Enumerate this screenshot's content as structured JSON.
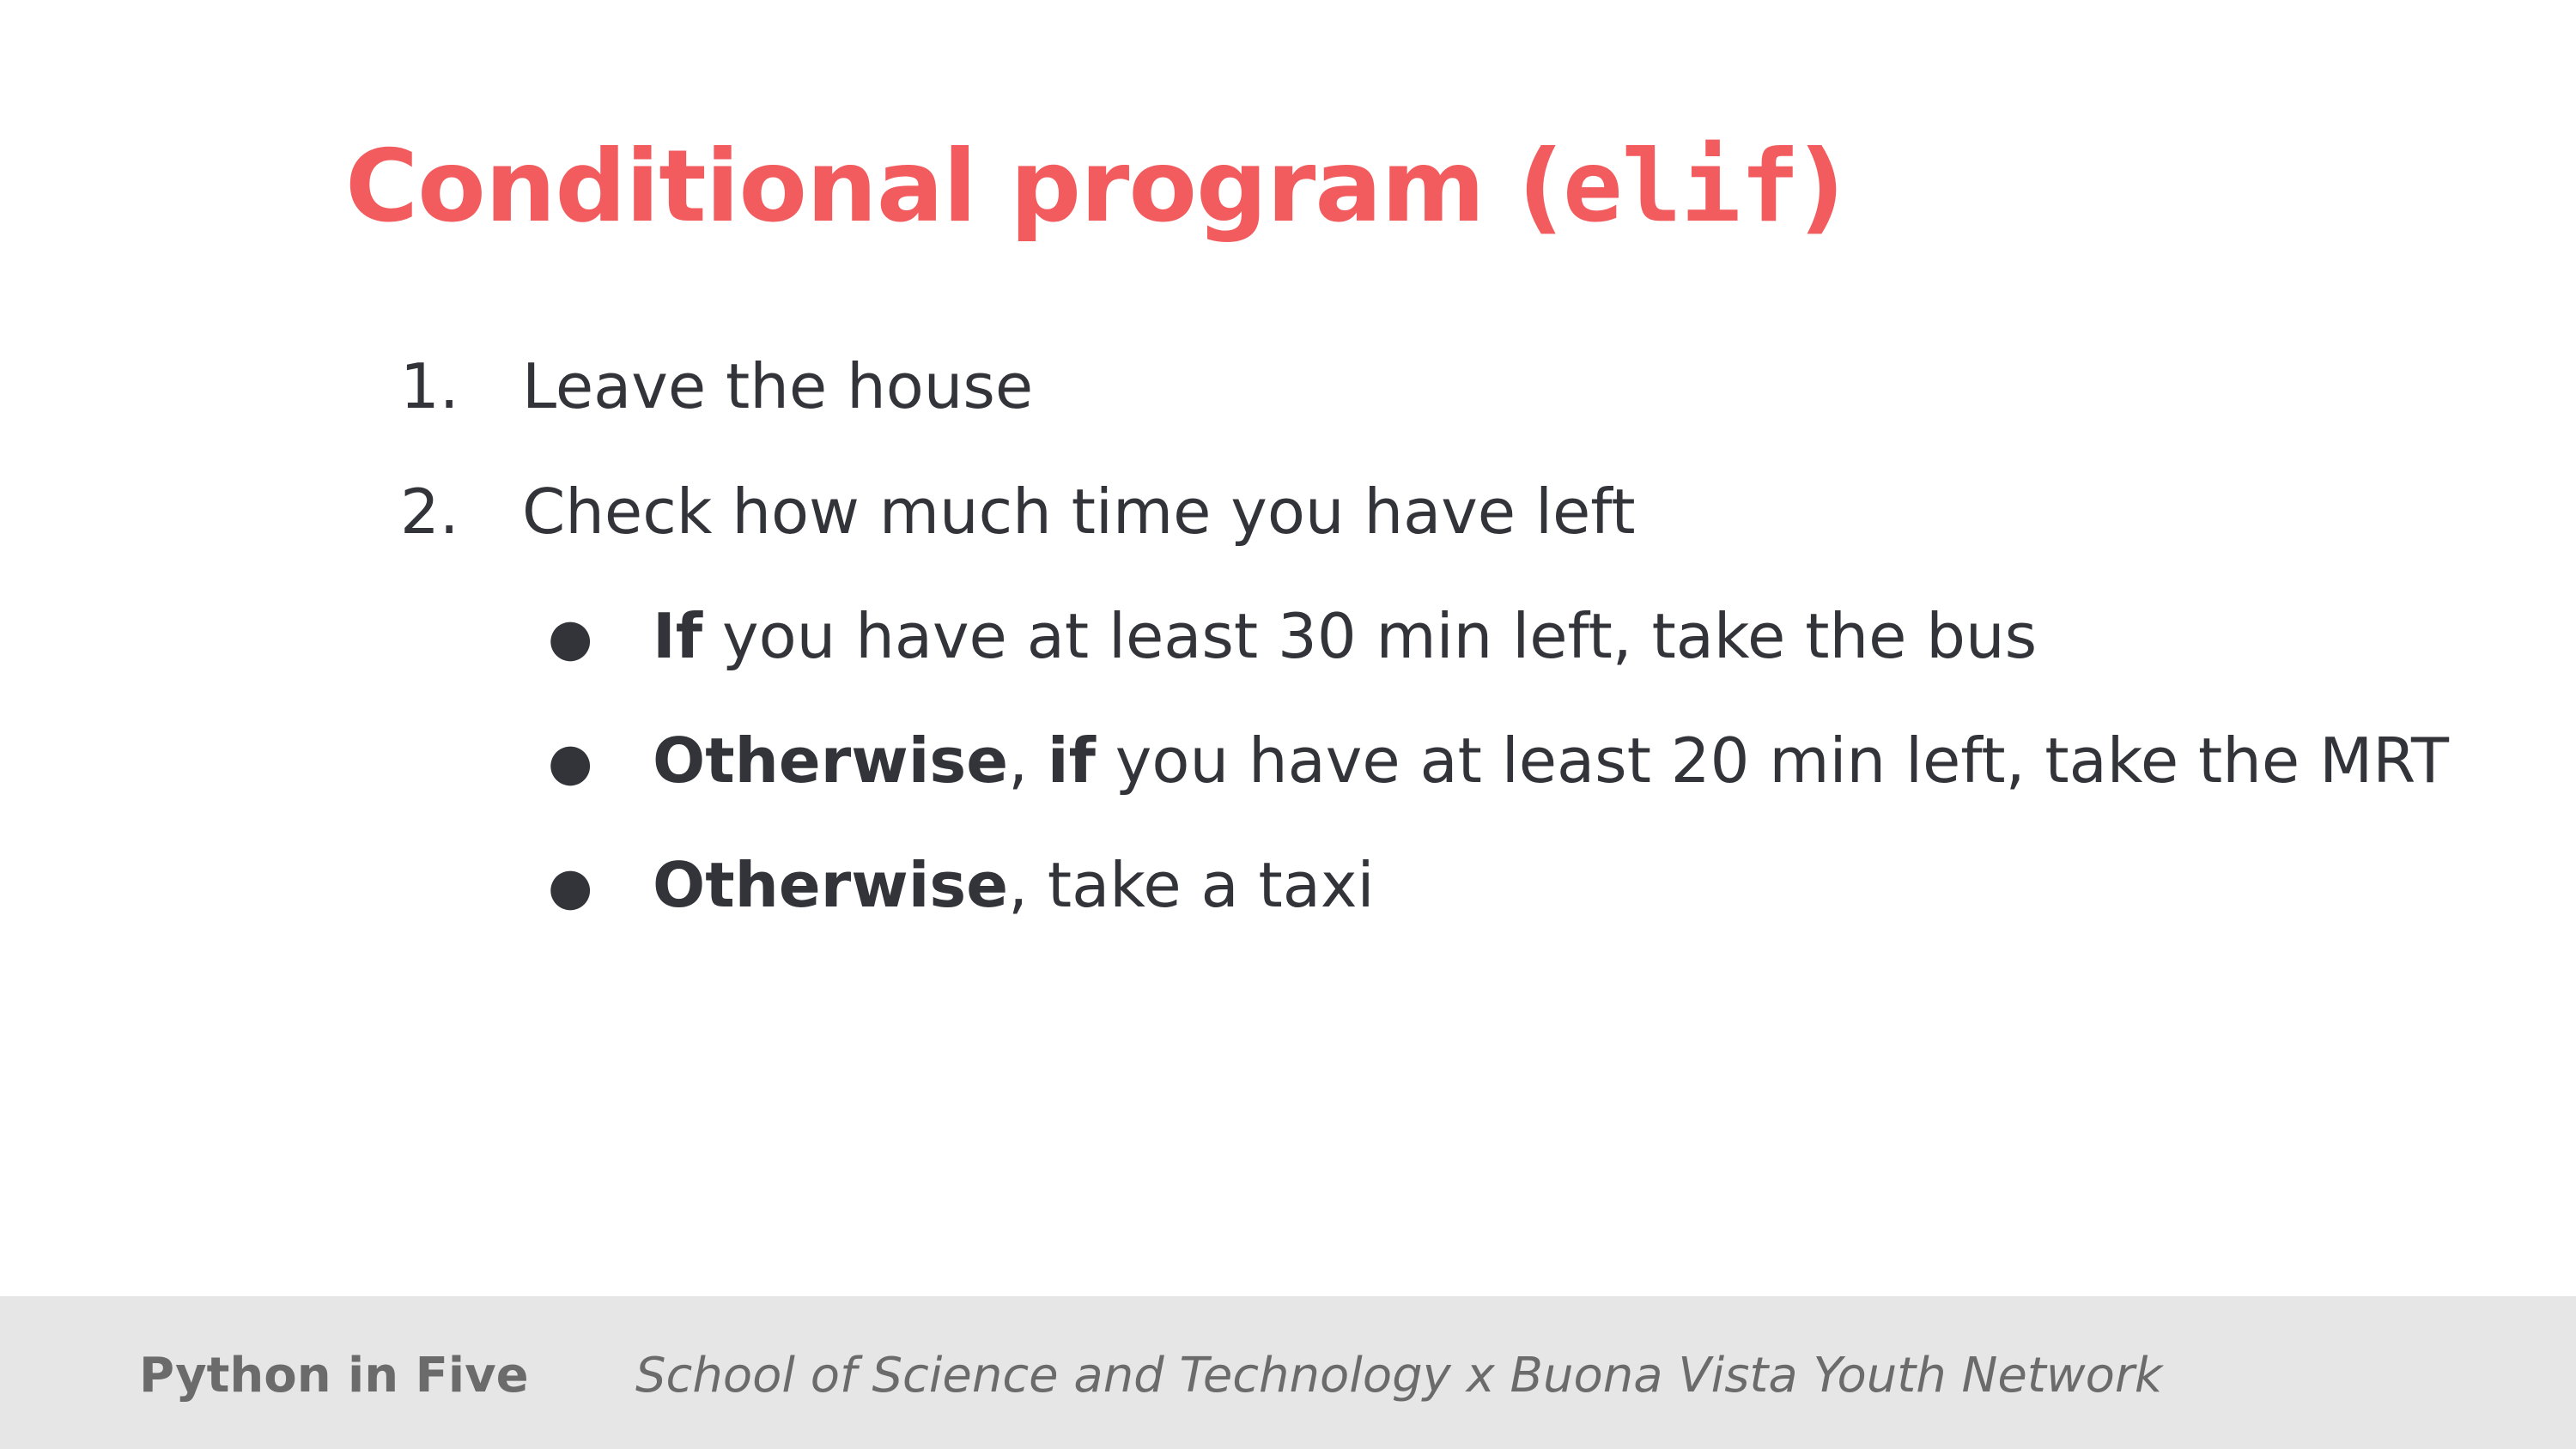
{
  "slide": {
    "title_prefix": "Conditional program (",
    "title_code": "elif",
    "title_suffix": ")"
  },
  "steps": [
    {
      "number": "1.",
      "text": "Leave the house"
    },
    {
      "number": "2.",
      "text": "Check how much time you have left"
    }
  ],
  "bullet_char": "●",
  "conditions": [
    {
      "kw1": "If",
      "sep": "",
      "kw2": "",
      "text": " you have at least 30 min left, take the bus"
    },
    {
      "kw1": "Otherwise",
      "sep": ", ",
      "kw2": "if",
      "text": " you have at least 20 min left, take the MRT"
    },
    {
      "kw1": "Otherwise",
      "sep": "",
      "kw2": "",
      "text": ", take a taxi"
    }
  ],
  "footer": {
    "brand": "Python in Five",
    "org": "School of Science and Technology x Buona Vista Youth Network"
  },
  "colors": {
    "title": "#f25c5e",
    "text": "#32343a",
    "footer_bg": "#e6e6e6",
    "footer_text": "#6b6b6b"
  }
}
